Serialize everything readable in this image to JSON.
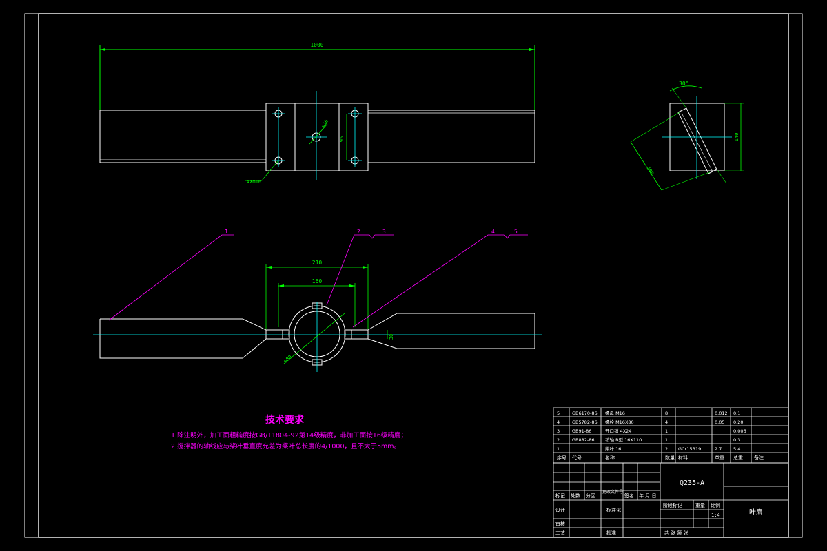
{
  "colors": {
    "background": "#000000",
    "frame": "#ffffff",
    "dimension": "#00ff00",
    "centerline": "#00ffff",
    "leader": "#ff00ff",
    "notes": "#ff00ff",
    "title_block": "#ffffff"
  },
  "top_view": {
    "overall_length": "1000",
    "hole_callout": "4Xφ16",
    "hole_spacing": "95",
    "center_hole": "φ16"
  },
  "side_view": {
    "angle": "30°",
    "height": "140",
    "diagonal": "100"
  },
  "front_view": {
    "width_outer": "210",
    "width_inner": "160",
    "thickness": "30",
    "ring_diameter": "φ80",
    "balloons": [
      "1",
      "2",
      "3",
      "4",
      "5"
    ]
  },
  "notes": {
    "title": "技术要求",
    "line1": "1.除注明外，加工面粗糙度按GB/T1804-92第14级精度，非加工面按16级精度；",
    "line2": "2.搅拌器的轴线应与桨叶垂直度允差为桨叶总长度的4/1000，且不大于5mm。"
  },
  "bom": {
    "rows": [
      {
        "no": "5",
        "code": "GB6170-86",
        "name": "螺母 M16",
        "qty": "8",
        "material": "",
        "unit": "0.012",
        "total": "0.1",
        "remark": ""
      },
      {
        "no": "4",
        "code": "GB5782-86",
        "name": "螺栓 M16X80",
        "qty": "4",
        "material": "",
        "unit": "0.05",
        "total": "0.20",
        "remark": ""
      },
      {
        "no": "3",
        "code": "GB91-86",
        "name": "开口销 4X24",
        "qty": "1",
        "material": "",
        "unit": "",
        "total": "0.006",
        "remark": ""
      },
      {
        "no": "2",
        "code": "GB882-86",
        "name": "销轴 B型 16X110",
        "qty": "1",
        "material": "",
        "unit": "",
        "total": "0.3",
        "remark": ""
      },
      {
        "no": "1",
        "code": "",
        "name": "桨叶 16",
        "qty": "2",
        "material": "GCr15B19",
        "unit": "2.7",
        "total": "5.4",
        "remark": ""
      }
    ],
    "header": {
      "no": "序号",
      "code": "代号",
      "name": "名称",
      "qty": "数量",
      "material": "材料",
      "unit": "单重",
      "total": "总重",
      "remark": "备注"
    }
  },
  "title_block": {
    "material": "Q235-A",
    "drawing_name": "叶扇",
    "scale_label": "比例",
    "scale": "1:4",
    "weight_label": "重量",
    "stage_label": "阶段标记",
    "sheet_text": "共  张  第  张",
    "row_labels": [
      "标记",
      "处数",
      "分区",
      "更改文件号",
      "签名",
      "年 月 日"
    ],
    "design": "设计",
    "standard": "标准化",
    "review": "审核",
    "process": "工艺",
    "approve": "批准"
  }
}
